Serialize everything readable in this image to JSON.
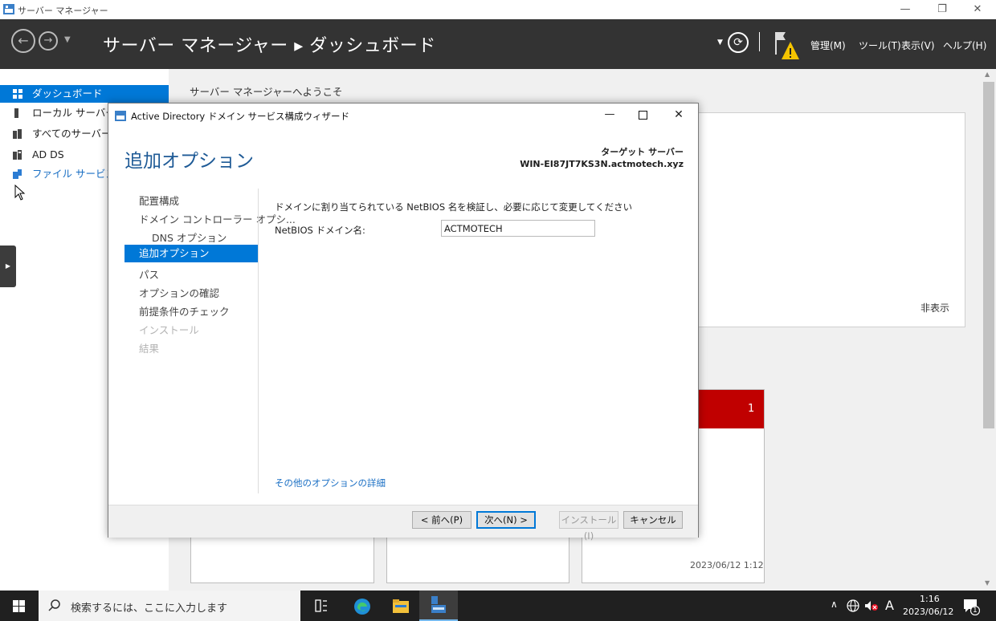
{
  "window": {
    "title": "サーバー マネージャー"
  },
  "header": {
    "breadcrumb": "サーバー マネージャー ▸ ダッシュボード",
    "menus": [
      "管理(M)",
      "ツール(T)",
      "表示(V)",
      "ヘルプ(H)"
    ]
  },
  "sidebar": {
    "items": [
      {
        "label": "ダッシュボード"
      },
      {
        "label": "ローカル サーバー"
      },
      {
        "label": "すべてのサーバー"
      },
      {
        "label": "AD DS"
      },
      {
        "label": "ファイル サービスと記憶域サービス"
      }
    ]
  },
  "main": {
    "welcome_title": "サーバー マネージャーへようこそ",
    "hide_link": "非表示",
    "tile_badge": "1",
    "tile_timestamp": "2023/06/12 1:12"
  },
  "dialog": {
    "title": "Active Directory ドメイン サービス構成ウィザード",
    "page_title": "追加オプション",
    "target_label": "ターゲット サーバー",
    "target_server": "WIN-EI87JT7KS3N.actmotech.xyz",
    "steps": [
      {
        "label": "配置構成"
      },
      {
        "label": "ドメイン コントローラー オプシ..."
      },
      {
        "label": "DNS オプション"
      },
      {
        "label": "追加オプション"
      },
      {
        "label": "パス"
      },
      {
        "label": "オプションの確認"
      },
      {
        "label": "前提条件のチェック"
      },
      {
        "label": "インストール"
      },
      {
        "label": "結果"
      }
    ],
    "instruction": "ドメインに割り当てられている NetBIOS 名を検証し、必要に応じて変更してください",
    "netbios_label": "NetBIOS ドメイン名:",
    "netbios_value": "ACTMOTECH",
    "more_link": "その他のオプションの詳細",
    "buttons": {
      "prev": "< 前へ(P)",
      "next": "次へ(N) >",
      "install": "インストール(I)",
      "cancel": "キャンセル"
    }
  },
  "taskbar": {
    "search_placeholder": "検索するには、ここに入力します",
    "ime": "A",
    "time": "1:16",
    "date": "2023/06/12",
    "notification_count": "1"
  },
  "colors": {
    "accent": "#0078d7",
    "header": "#333333",
    "badge_red": "#c00000",
    "heading_blue": "#1e5a96"
  }
}
